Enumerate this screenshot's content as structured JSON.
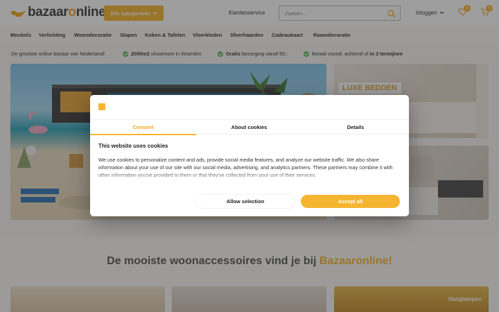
{
  "header": {
    "logo": {
      "part1": "bazaar",
      "part2": "o",
      "part3": "nline"
    },
    "categories_button": "Alle categorieën",
    "customer_service": "Klantenservice",
    "search": {
      "placeholder": "Zoeken..."
    },
    "login": "Inloggen",
    "wishlist_count": "0",
    "cart_count": "0"
  },
  "nav": {
    "items": [
      "Meubels",
      "Verlichting",
      "Woondecoratie",
      "Slapen",
      "Koken & Tafelen",
      "Vloerkleden",
      "Sfeerhaarden",
      "Cadeaukaart",
      "Raamdecoratie"
    ]
  },
  "usp": {
    "intro": "De grootste online bazaar van Nederland!",
    "showroom_bold": "2000m2",
    "showroom_rest": " showroom in Woerden",
    "shipping_bold": "Gratis",
    "shipping_rest": " bezorging vanaf 50,-",
    "payment_rest": "Betaal vooraf, achteraf of ",
    "payment_bold": "in 3 termijnen"
  },
  "banners": {
    "side1_label": "LUXE BEDDEN",
    "card3_label": "Hanglampen"
  },
  "section": {
    "heading_main": "De mooiste woonaccessoires vind je bij ",
    "heading_highlight": "Bazaaronline!"
  },
  "consent": {
    "tabs": [
      "Consent",
      "About cookies",
      "Details"
    ],
    "title": "This website uses cookies",
    "body": "We use cookies to personalize content and ads, provide social media features, and analyze our website traffic. We also share information about your use of our site with our social media, advertising, and analytics partners. These partners may combine it with other information you've provided to them or that they've collected from your use of their services.",
    "allow_selection": "Allow selection",
    "accept_all": "Accept all"
  },
  "colors": {
    "accent": "#f6b531",
    "check": "#5cb85c"
  }
}
